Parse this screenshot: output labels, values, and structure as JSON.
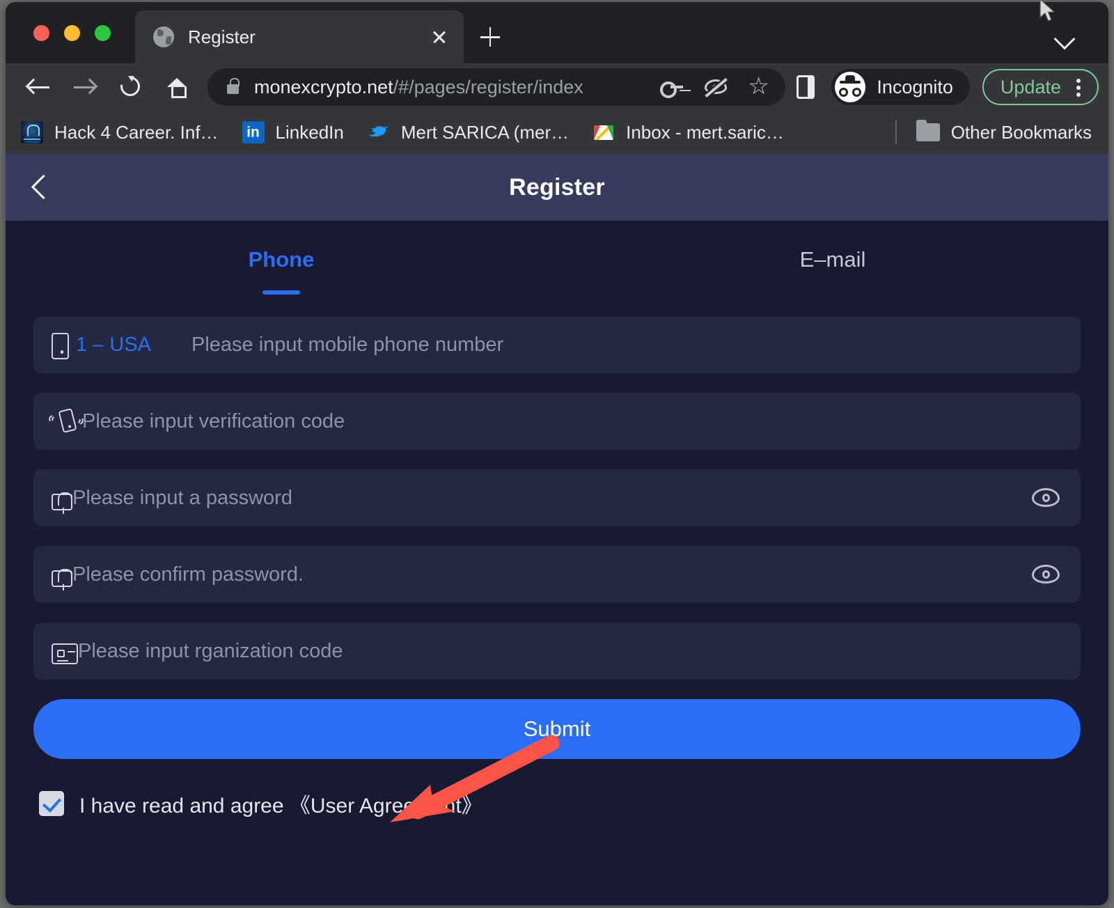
{
  "browser": {
    "tab": {
      "title": "Register",
      "favicon": "globe-icon",
      "close": "close-icon"
    },
    "new_tab": "new-tab-icon",
    "tab_list": "chevron-down-icon",
    "toolbar": {
      "back": "back-arrow-icon",
      "forward": "forward-arrow-icon",
      "reload": "reload-icon",
      "home": "home-icon",
      "lock": "lock-icon",
      "url_host": "monexcrypto.net",
      "url_path": "/#/pages/register/index",
      "password_manager": "key-icon",
      "tracking_protection": "eye-off-icon",
      "bookmark": "star-icon",
      "side_panel": "side-panel-icon",
      "profile_label": "Incognito",
      "profile_icon": "incognito-icon",
      "update_label": "Update",
      "menu": "kebab-menu-icon"
    },
    "bookmarks": [
      {
        "label": "Hack 4 Career. Inf…",
        "icon": "hack4career-favicon"
      },
      {
        "label": "LinkedIn",
        "icon": "linkedin-favicon"
      },
      {
        "label": "Mert SARICA (mer…",
        "icon": "twitter-favicon"
      },
      {
        "label": "Inbox - mert.saric…",
        "icon": "gmail-favicon"
      }
    ],
    "other_bookmarks": {
      "label": "Other Bookmarks",
      "icon": "folder-icon"
    }
  },
  "page": {
    "header": {
      "back_icon": "chevron-left-icon",
      "title": "Register"
    },
    "tabs": [
      {
        "label": "Phone",
        "active": true
      },
      {
        "label": "E–mail",
        "active": false
      }
    ],
    "fields": [
      {
        "name": "phone",
        "icon": "mobile-phone-icon",
        "country_code": "1 – USA",
        "placeholder": "Please input mobile phone number",
        "value": ""
      },
      {
        "name": "verification-code",
        "icon": "phone-vibrate-icon",
        "placeholder": "Please input verification code",
        "value": ""
      },
      {
        "name": "password",
        "icon": "lock-icon",
        "placeholder": "Please input a password",
        "value": "",
        "toggle_icon": "eye-icon"
      },
      {
        "name": "confirm-password",
        "icon": "lock-icon",
        "placeholder": "Please confirm password.",
        "value": "",
        "toggle_icon": "eye-icon"
      },
      {
        "name": "organization-code",
        "icon": "id-card-icon",
        "placeholder": "Please input rganization code",
        "value": ""
      }
    ],
    "submit_label": "Submit",
    "agreement": {
      "checked": true,
      "text": "I have read and agree 《User Agreement》"
    }
  },
  "annotation": {
    "type": "arrow",
    "color": "#fa5547",
    "points_to": "organization-code-field"
  },
  "colors": {
    "page_background": "#171a31",
    "page_header": "#363c5f",
    "field_background": "#242941",
    "accent_blue": "#2b6ef5",
    "placeholder_text": "#8e93a6",
    "annotation_red": "#fa5547",
    "update_green": "#81c995"
  }
}
